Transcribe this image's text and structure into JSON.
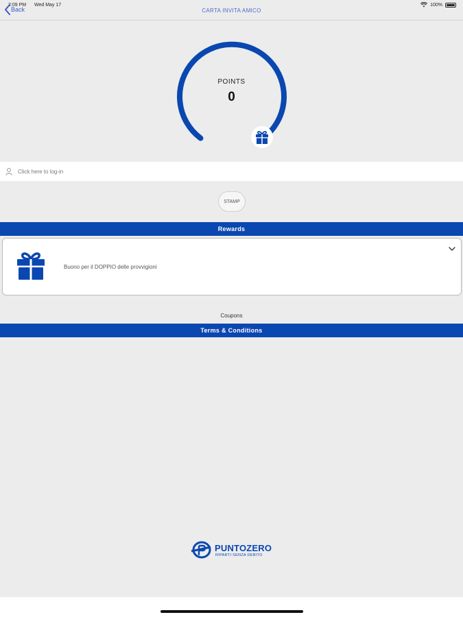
{
  "status_bar": {
    "time": "2:09 PM",
    "date": "Wed May 17",
    "battery": "100%",
    "wifi_icon": "wifi-icon",
    "battery_icon": "battery-icon"
  },
  "nav": {
    "back_label": "Back",
    "title": "CARTA INVITA AMICO"
  },
  "points": {
    "label": "POINTS",
    "value": "0",
    "gauge_progress": 0
  },
  "login": {
    "label": "Click here to log-in",
    "icon": "person-icon"
  },
  "stamp": {
    "label": "STAMP"
  },
  "rewards": {
    "header": "Rewards",
    "items": [
      {
        "text": "Buono per il DOPPIO delle provvigioni",
        "icon": "gift-icon"
      }
    ]
  },
  "coupons": {
    "label": "Coupons"
  },
  "terms": {
    "header": "Terms & Conditions"
  },
  "brand": {
    "name": "PUNTOZERO",
    "tagline": "RIPARTI SENZA DEBITO"
  },
  "colors": {
    "accent": "#0a47b0",
    "background": "#ececec",
    "link": "#3a5cc7"
  }
}
